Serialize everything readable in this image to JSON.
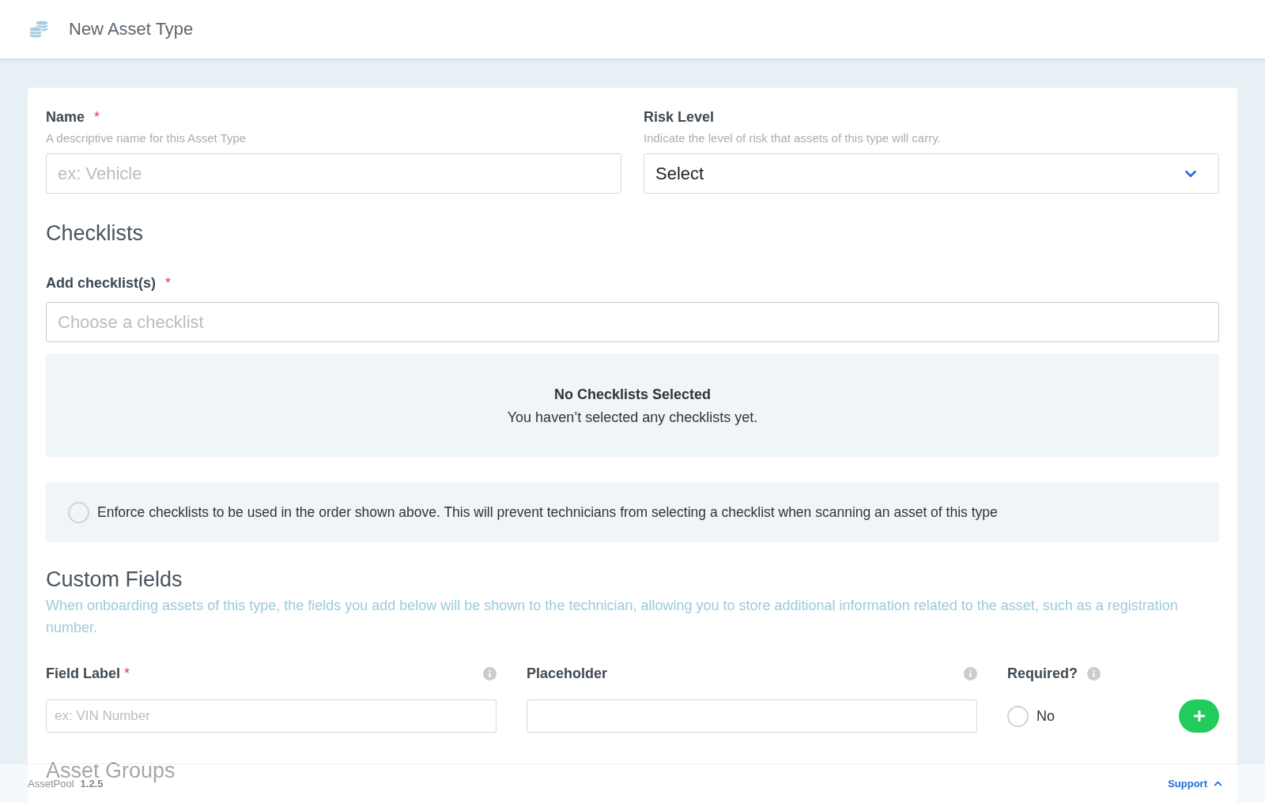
{
  "header": {
    "title": "New Asset Type"
  },
  "details": {
    "name": {
      "label": "Name",
      "required_mark": "*",
      "hint": "A descriptive name for this Asset Type",
      "placeholder": "ex: Vehicle"
    },
    "risk_level": {
      "label": "Risk Level",
      "hint": "Indicate the level of risk that assets of this type will carry.",
      "value": "Select"
    }
  },
  "checklists": {
    "heading": "Checklists",
    "field": {
      "label": "Add checklist(s)",
      "required_mark": "*",
      "placeholder": "Choose a checklist"
    },
    "empty_state": {
      "title": "No Checklists Selected",
      "message": "You haven’t selected any checklists yet."
    },
    "enforce_order": {
      "checked": false,
      "label": "Enforce checklists to be used in the order shown above. This will prevent technicians from selecting a checklist when scanning an asset of this type"
    }
  },
  "custom_fields": {
    "heading": "Custom Fields",
    "description": "When onboarding assets of this type, the fields you add below will be shown to the technician, allowing you to store additional information related to the asset, such as a registration number.",
    "columns": [
      {
        "label": "Field Label",
        "required_mark": "*"
      },
      {
        "label": "Placeholder"
      },
      {
        "label": "Required?"
      }
    ],
    "new_field": {
      "label_placeholder": "ex: VIN Number",
      "required": {
        "checked": false,
        "label": "No"
      }
    }
  },
  "asset_groups": {
    "heading": "Asset Groups"
  },
  "footer": {
    "app_name": "AssetPool",
    "version": "1.2.5",
    "support": "Support"
  }
}
